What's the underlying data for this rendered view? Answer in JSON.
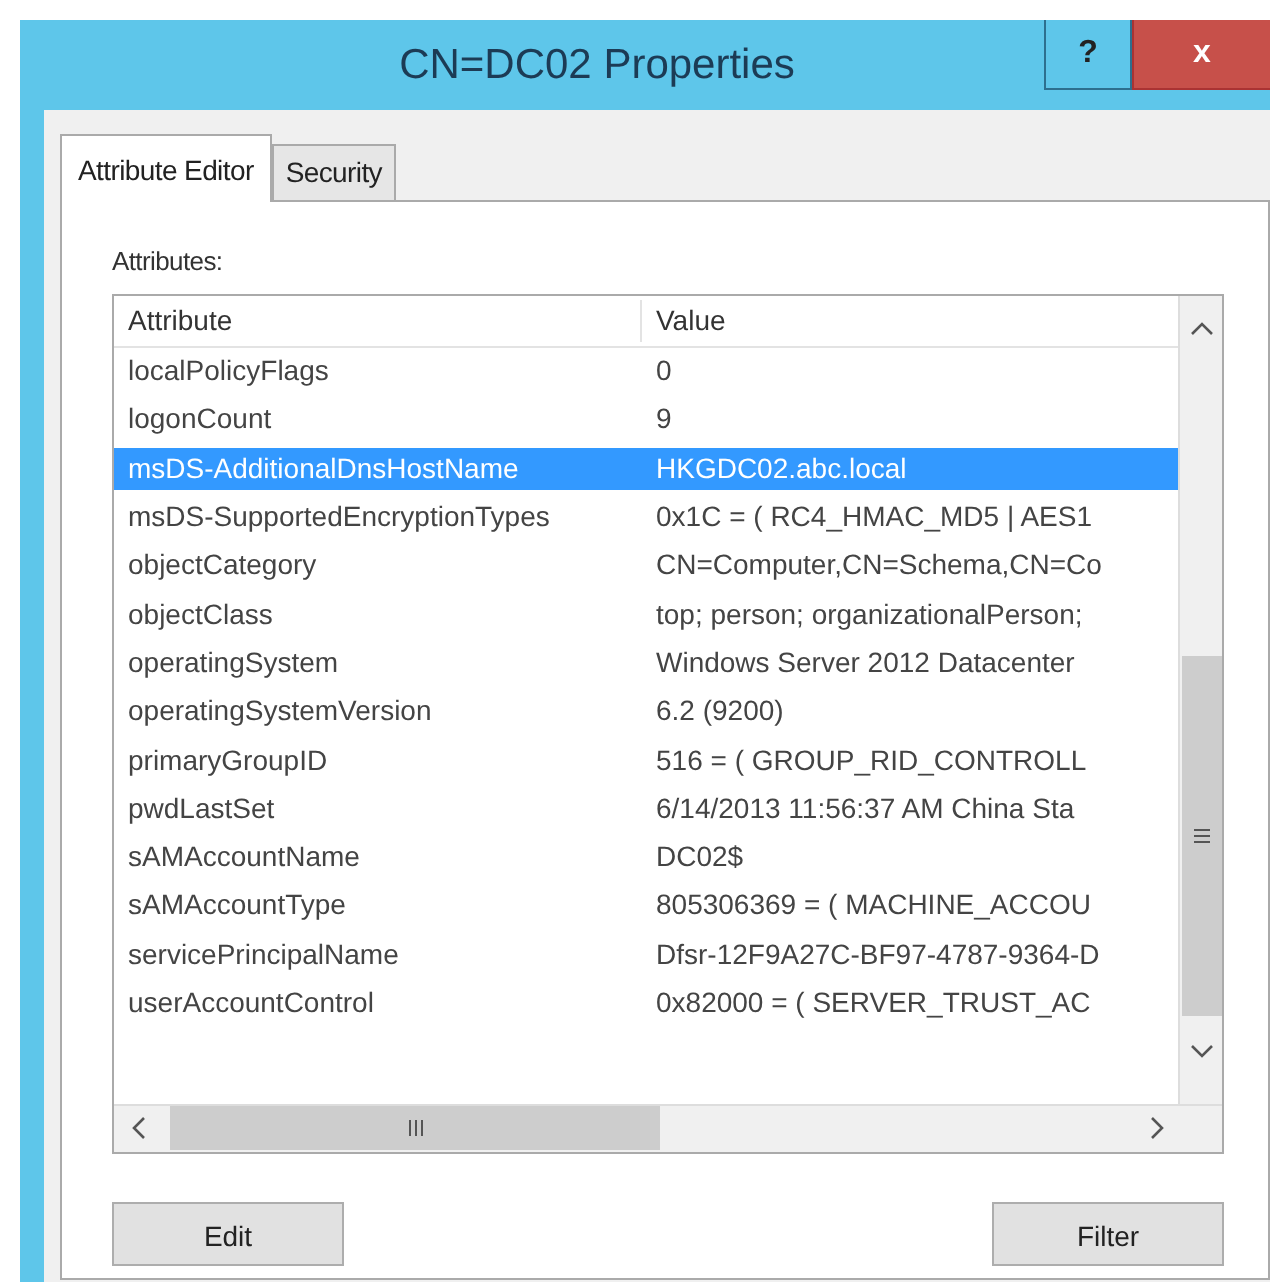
{
  "window": {
    "title": "CN=DC02 Properties",
    "buttons": [
      {
        "kind": "help",
        "label": "?"
      },
      {
        "kind": "close",
        "label": "x"
      }
    ]
  },
  "tabs": [
    {
      "label": "Attribute Editor",
      "selected": true
    },
    {
      "label": "Security",
      "selected": false
    }
  ],
  "attributes_label": "Attributes:",
  "table": {
    "columns": [
      "Attribute",
      "Value"
    ],
    "rows": [
      {
        "attribute": "localPolicyFlags",
        "value": "0",
        "selected": false
      },
      {
        "attribute": "logonCount",
        "value": "9",
        "selected": false
      },
      {
        "attribute": "msDS-AdditionalDnsHostName",
        "value": "HKGDC02.abc.local",
        "selected": true
      },
      {
        "attribute": "msDS-SupportedEncryptionTypes",
        "value": "0x1C = ( RC4_HMAC_MD5 | AES1",
        "selected": false
      },
      {
        "attribute": "objectCategory",
        "value": "CN=Computer,CN=Schema,CN=Co",
        "selected": false
      },
      {
        "attribute": "objectClass",
        "value": "top; person; organizationalPerson;",
        "selected": false
      },
      {
        "attribute": "operatingSystem",
        "value": "Windows Server 2012 Datacenter",
        "selected": false
      },
      {
        "attribute": "operatingSystemVersion",
        "value": "6.2 (9200)",
        "selected": false
      },
      {
        "attribute": "primaryGroupID",
        "value": "516 = ( GROUP_RID_CONTROLL",
        "selected": false
      },
      {
        "attribute": "pwdLastSet",
        "value": "6/14/2013 11:56:37 AM China Sta",
        "selected": false
      },
      {
        "attribute": "sAMAccountName",
        "value": "DC02$",
        "selected": false
      },
      {
        "attribute": "sAMAccountType",
        "value": "805306369 = ( MACHINE_ACCOU",
        "selected": false
      },
      {
        "attribute": "servicePrincipalName",
        "value": "Dfsr-12F9A27C-BF97-4787-9364-D",
        "selected": false
      },
      {
        "attribute": "userAccountControl",
        "value": "0x82000 = ( SERVER_TRUST_AC",
        "selected": false
      }
    ]
  },
  "buttons": [
    {
      "label": "Edit"
    },
    {
      "label": "Filter"
    }
  ]
}
